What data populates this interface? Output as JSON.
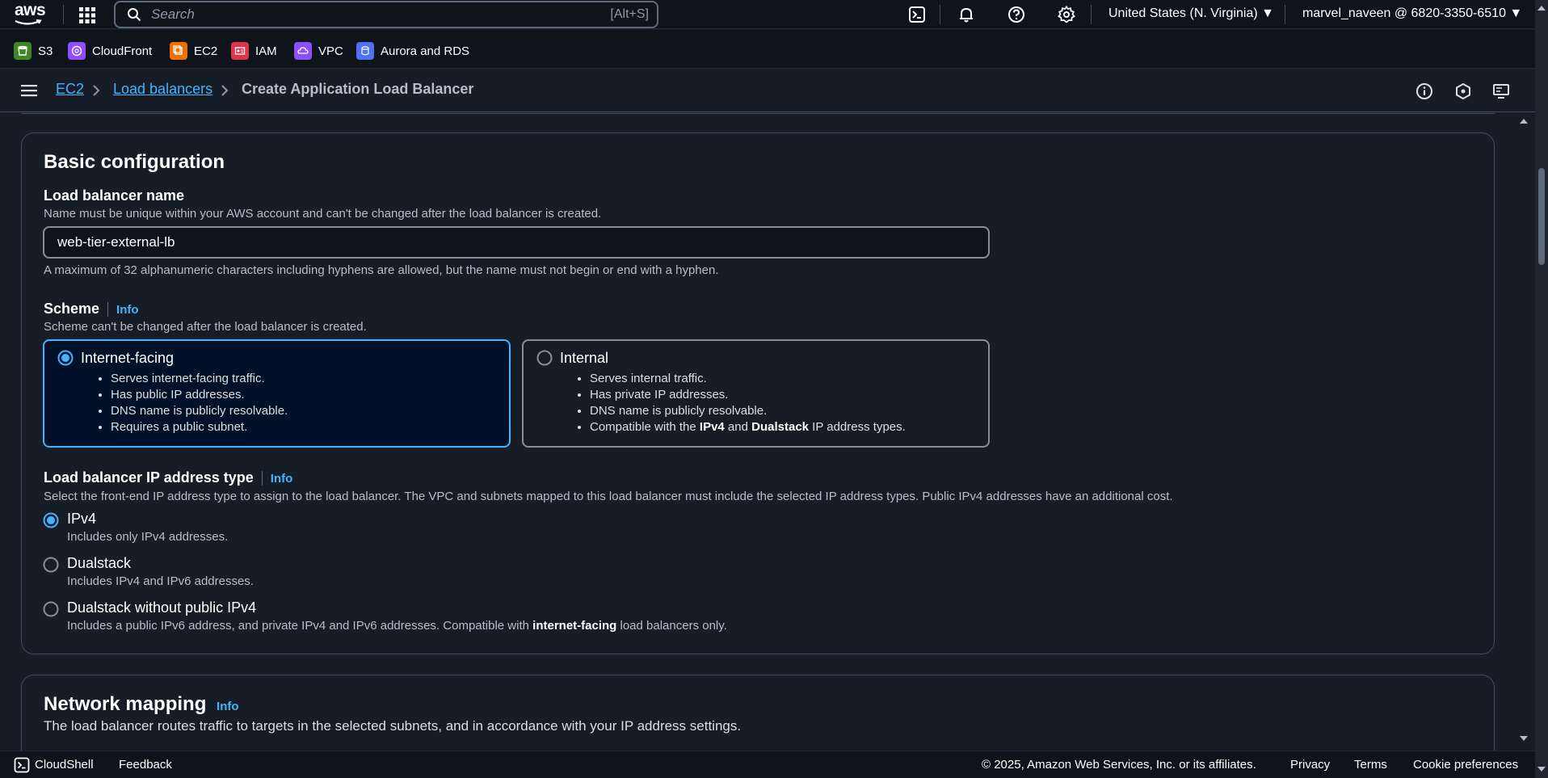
{
  "topnav": {
    "logo": "aws",
    "search_placeholder": "Search",
    "search_shortcut": "[Alt+S]",
    "region": "United States (N. Virginia) ▼",
    "account": "marvel_naveen @ 6820-3350-6510 ▼",
    "icons": [
      "services-grid-icon",
      "search-icon",
      "cloudshell-icon",
      "bell-icon",
      "help-icon",
      "settings-icon"
    ]
  },
  "favorites": [
    {
      "label": "S3",
      "color": "#3f8624"
    },
    {
      "label": "CloudFront",
      "color": "#8c4fff"
    },
    {
      "label": "EC2",
      "color": "#ed7100"
    },
    {
      "label": "IAM",
      "color": "#dd344c"
    },
    {
      "label": "VPC",
      "color": "#8c4fff"
    },
    {
      "label": "Aurora and RDS",
      "color": "#4d72f3"
    }
  ],
  "breadcrumb": {
    "items": [
      "EC2",
      "Load balancers",
      "Create Application Load Balancer"
    ]
  },
  "basic_config": {
    "title": "Basic configuration",
    "name_label": "Load balancer name",
    "name_desc": "Name must be unique within your AWS account and can't be changed after the load balancer is created.",
    "name_value": "web-tier-external-lb",
    "name_constraint": "A maximum of 32 alphanumeric characters including hyphens are allowed, but the name must not begin or end with a hyphen.",
    "scheme_label": "Scheme",
    "info": "Info",
    "scheme_desc": "Scheme can't be changed after the load balancer is created.",
    "scheme_options": [
      {
        "title": "Internet-facing",
        "selected": true,
        "bullets": [
          "Serves internet-facing traffic.",
          "Has public IP addresses.",
          "DNS name is publicly resolvable.",
          "Requires a public subnet."
        ]
      },
      {
        "title": "Internal",
        "selected": false,
        "bullets": [
          "Serves internal traffic.",
          "Has private IP addresses.",
          "DNS name is publicly resolvable."
        ],
        "bullet_last_pre": "Compatible with the ",
        "bullet_last_b1": "IPv4",
        "bullet_last_mid": " and ",
        "bullet_last_b2": "Dualstack",
        "bullet_last_post": " IP address types."
      }
    ],
    "ip_label": "Load balancer IP address type",
    "ip_desc": "Select the front-end IP address type to assign to the load balancer. The VPC and subnets mapped to this load balancer must include the selected IP address types. Public IPv4 addresses have an additional cost.",
    "ip_options": [
      {
        "title": "IPv4",
        "desc": "Includes only IPv4 addresses.",
        "selected": true
      },
      {
        "title": "Dualstack",
        "desc": "Includes IPv4 and IPv6 addresses.",
        "selected": false
      },
      {
        "title": "Dualstack without public IPv4",
        "desc_pre": "Includes a public IPv6 address, and private IPv4 and IPv6 addresses. Compatible with ",
        "desc_b": "internet-facing",
        "desc_post": " load balancers only.",
        "selected": false
      }
    ]
  },
  "network_mapping": {
    "title": "Network mapping",
    "info": "Info",
    "desc": "The load balancer routes traffic to targets in the selected subnets, and in accordance with your IP address settings."
  },
  "footer": {
    "cloudshell": "CloudShell",
    "feedback": "Feedback",
    "copyright": "© 2025, Amazon Web Services, Inc. or its affiliates.",
    "privacy": "Privacy",
    "terms": "Terms",
    "cookies": "Cookie preferences"
  },
  "colors": {
    "accent": "#42b4ff",
    "background": "#161d26",
    "nav": "#0f141a"
  }
}
